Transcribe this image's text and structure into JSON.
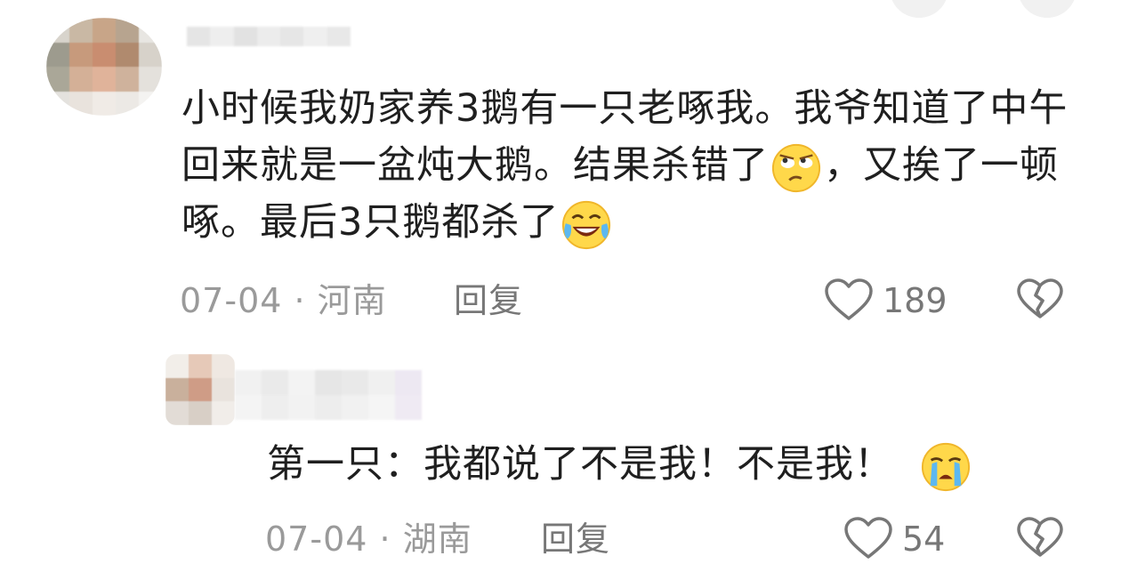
{
  "comments": [
    {
      "text_parts": [
        "小时候我奶家养3鹅有一只老啄我。我爷知道了中午回来就是一盆炖大鹅。结果杀错了",
        "，又挨了一顿啄。最后3只鹅都杀了"
      ],
      "emoji_after_part1": "rolling-eyes-emoji",
      "emoji_after_part2": "laughing-tears-emoji",
      "date": "07-04",
      "separator": "·",
      "location": "河南",
      "reply_label": "回复",
      "likes": "189"
    },
    {
      "text": "第一只：我都说了不是我！不是我！",
      "emoji_end": "crying-emoji",
      "date": "07-04",
      "separator": "·",
      "location": "湖南",
      "reply_label": "回复",
      "likes": "54"
    }
  ],
  "icons": {
    "like": "heart-outline-icon",
    "dislike": "broken-heart-icon"
  },
  "colors": {
    "text": "#1f1f1f",
    "meta": "#9a9a9a",
    "icon": "#777777"
  }
}
